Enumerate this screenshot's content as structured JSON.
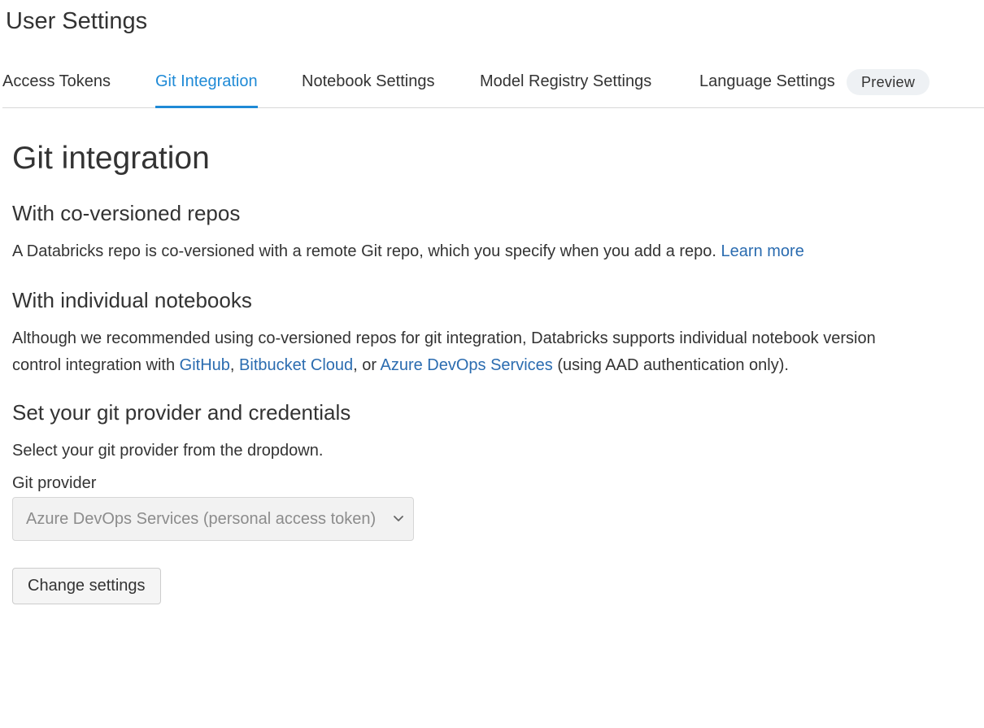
{
  "page": {
    "title": "User Settings"
  },
  "tabs": [
    {
      "label": "Access Tokens"
    },
    {
      "label": "Git Integration"
    },
    {
      "label": "Notebook Settings"
    },
    {
      "label": "Model Registry Settings"
    },
    {
      "label": "Language Settings",
      "badge": "Preview"
    }
  ],
  "active_tab": "Git Integration",
  "colors": {
    "accent": "#1f8ad6",
    "link": "#2b6cb0",
    "text": "#333333"
  },
  "main": {
    "heading": "Git integration",
    "repos": {
      "heading": "With co-versioned repos",
      "text": "A Databricks repo is co-versioned with a remote Git repo, which you specify when you add a repo. ",
      "link": "Learn more"
    },
    "notebooks": {
      "heading": "With individual notebooks",
      "text_1": "Although we recommended using co-versioned repos for git integration, Databricks supports individual notebook version control integration with ",
      "link_github": "GitHub",
      "sep_1": ", ",
      "link_bitbucket": "Bitbucket Cloud",
      "sep_2": ", or ",
      "link_azure": "Azure DevOps Services",
      "text_2": " (using AAD authentication only)."
    },
    "provider": {
      "heading": "Set your git provider and credentials",
      "instruction": "Select your git provider from the dropdown.",
      "field_label": "Git provider",
      "selected_value": "Azure DevOps Services (personal access token)",
      "icon": "chevron-down-icon"
    },
    "button_label": "Change settings"
  }
}
